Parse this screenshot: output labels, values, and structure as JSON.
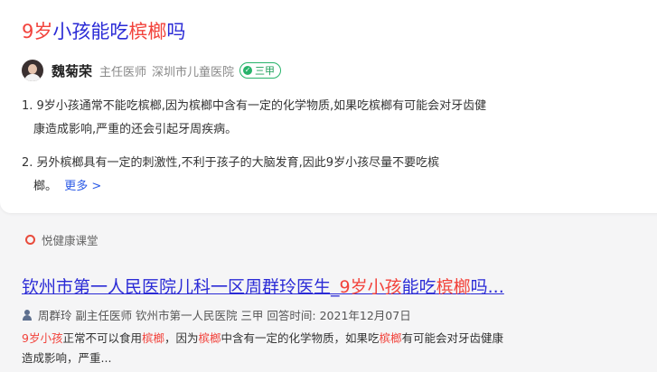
{
  "answer_card": {
    "title_parts": [
      "9岁",
      "小孩能吃",
      "槟榔",
      "吗"
    ],
    "doctor": {
      "name": "魏菊荣",
      "title": "主任医师",
      "hospital": "深圳市儿童医院",
      "badge": "三甲"
    },
    "points": [
      {
        "line1": "1. 9岁小孩通常不能吃槟榔,因为槟榔中含有一定的化学物质,如果吃槟榔有可能会对牙齿健",
        "line2": "康造成影响,严重的还会引起牙周疾病。"
      },
      {
        "line1": "2. 另外槟榔具有一定的刺激性,不利于孩子的大脑发育,因此9岁小孩尽量不要吃槟",
        "line2": "榔。"
      }
    ],
    "more_link": "更多 >"
  },
  "source": {
    "name": "悦健康课堂"
  },
  "result2": {
    "title_parts": [
      "钦州市第一人民医院儿科一区周群玲医生_",
      "9岁小孩",
      "能吃",
      "槟榔",
      "吗..."
    ],
    "meta": "周群玲 副主任医师 钦州市第一人民医院 三甲 回答时间: 2021年12月07日",
    "snippet_parts": [
      "9岁小孩",
      "正常不可以食用",
      "槟榔",
      "，因为",
      "槟榔",
      "中含有一定的化学物质，如果吃",
      "槟榔",
      "有可能会对牙齿健康"
    ],
    "snippet_line2": "造成影响，严重..."
  },
  "colors": {
    "link": "#2b2bd6",
    "highlight": "#f2433c",
    "badge_green": "#27b36a",
    "more_blue": "#2b5ae6"
  }
}
